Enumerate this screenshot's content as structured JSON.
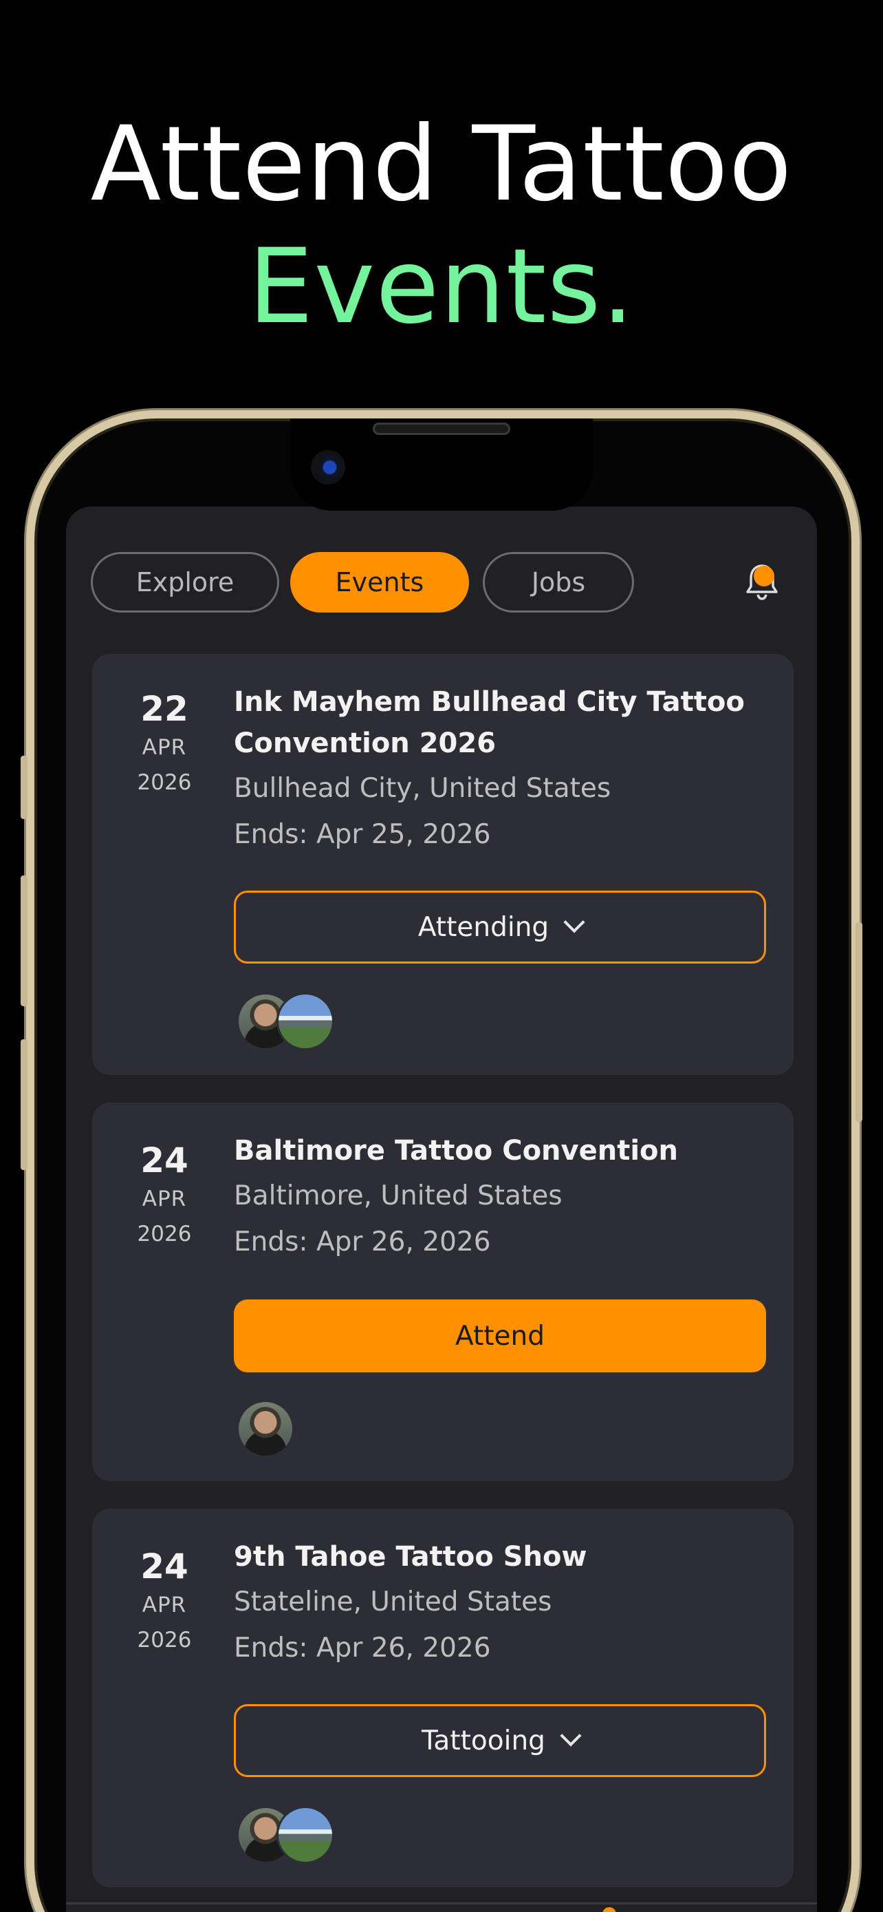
{
  "hero": {
    "line1": "Attend Tattoo",
    "line2": "Events."
  },
  "tabs": [
    {
      "label": "Explore",
      "active": false
    },
    {
      "label": "Events",
      "active": true
    },
    {
      "label": "Jobs",
      "active": false
    }
  ],
  "notification": {
    "icon": "bell-icon",
    "has_unread": true
  },
  "events": [
    {
      "day": "22",
      "month": "APR",
      "year": "2026",
      "title": "Ink Mayhem Bullhead City Tattoo Convention 2026",
      "location": "Bullhead City, United States",
      "ends": "Ends: Apr 25, 2026",
      "button": "Attending",
      "button_style": "outline-dropdown",
      "attendee_avatars": [
        "person-avatar",
        "landscape-avatar"
      ]
    },
    {
      "day": "24",
      "month": "APR",
      "year": "2026",
      "title": "Baltimore Tattoo Convention",
      "location": "Baltimore, United States",
      "ends": "Ends: Apr 26, 2026",
      "button": "Attend",
      "button_style": "filled",
      "attendee_avatars": [
        "person-avatar"
      ]
    },
    {
      "day": "24",
      "month": "APR",
      "year": "2026",
      "title": "9th Tahoe Tattoo Show",
      "location": "Stateline, United States",
      "ends": "Ends: Apr 26, 2026",
      "button": "Tattooing",
      "button_style": "outline-dropdown",
      "attendee_avatars": [
        "person-avatar",
        "landscape-avatar"
      ]
    }
  ],
  "colors": {
    "accent": "#ff9000",
    "highlight": "#74f29c",
    "card": "#2d2d36",
    "screen": "#202025"
  }
}
